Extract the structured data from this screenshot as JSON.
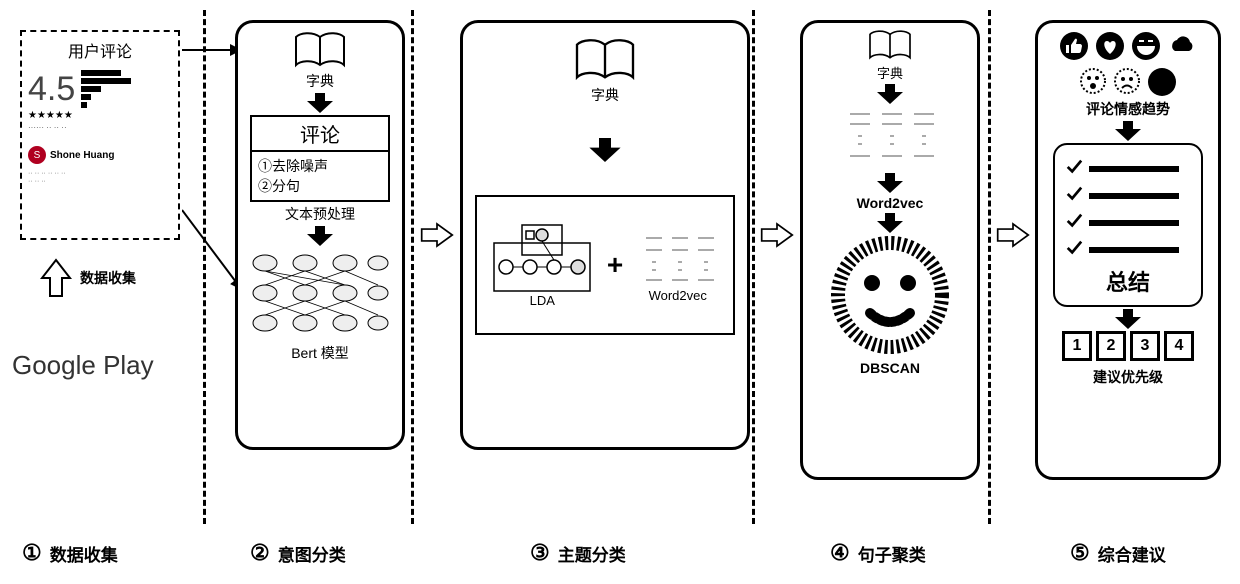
{
  "stages": {
    "s1": {
      "num": "①",
      "label": "数据收集"
    },
    "s2": {
      "num": "②",
      "label": "意图分类"
    },
    "s3": {
      "num": "③",
      "label": "主题分类"
    },
    "s4": {
      "num": "④",
      "label": "句子聚类"
    },
    "s5": {
      "num": "⑤",
      "label": "综合建议"
    }
  },
  "stage1": {
    "panel_title": "用户评论",
    "rating": "4.5",
    "username": "Shone Huang",
    "arrow_label": "数据收集",
    "source_label": "Google Play"
  },
  "stage2": {
    "dict_label": "字典",
    "review_title": "评论",
    "step1": "①去除噪声",
    "step2": "②分句",
    "preprocess_label": "文本预处理",
    "model_label": "Bert 模型"
  },
  "stage3": {
    "dict_label": "字典",
    "lda_label": "LDA",
    "w2v_label": "Word2vec",
    "plus": "+"
  },
  "stage4": {
    "dict_label": "字典",
    "w2v_label": "Word2vec",
    "dbscan_label": "DBSCAN"
  },
  "stage5": {
    "sentiment_label": "评论情感趋势",
    "summary_label": "总结",
    "priority_label": "建议优先级",
    "priorities": [
      "1",
      "2",
      "3",
      "4"
    ]
  }
}
